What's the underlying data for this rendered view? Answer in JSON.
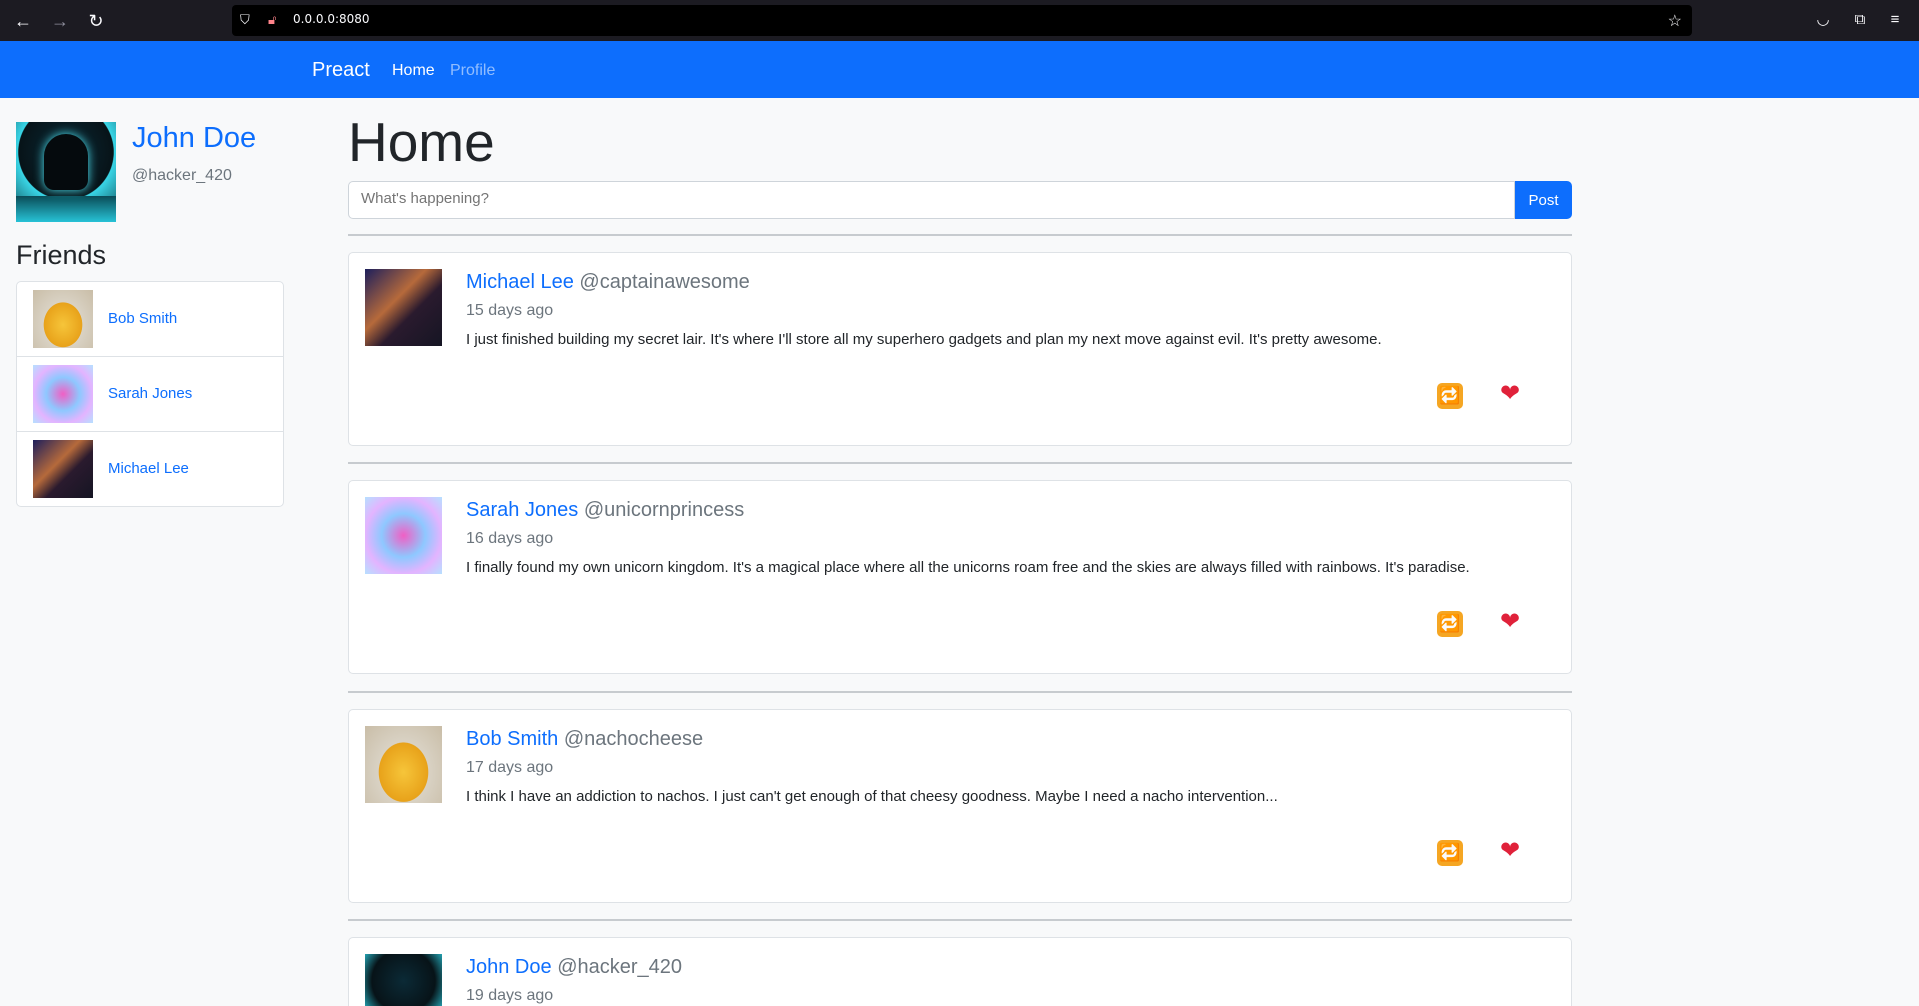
{
  "browser": {
    "url": "0.0.0.0:8080"
  },
  "navbar": {
    "brand": "Preact",
    "links": [
      "Home",
      "Profile"
    ]
  },
  "profile": {
    "name": "John Doe",
    "handle": "@hacker_420"
  },
  "friends": {
    "title": "Friends",
    "items": [
      {
        "name": "Bob Smith",
        "avatar": "nacho-cheese-photo"
      },
      {
        "name": "Sarah Jones",
        "avatar": "unicorn-photo"
      },
      {
        "name": "Michael Lee",
        "avatar": "superhero-photo"
      }
    ]
  },
  "main": {
    "title": "Home",
    "compose_placeholder": "What's happening?",
    "post_label": "Post"
  },
  "posts": [
    {
      "name": "Michael Lee",
      "handle": "@captainawesome",
      "time": "15 days ago",
      "body": "I just finished building my secret lair. It's where I'll store all my superhero gadgets and plan my next move against evil. It's pretty awesome.",
      "avatar": "superhero-photo"
    },
    {
      "name": "Sarah Jones",
      "handle": "@unicornprincess",
      "time": "16 days ago",
      "body": "I finally found my own unicorn kingdom. It's a magical place where all the unicorns roam free and the skies are always filled with rainbows. It's paradise.",
      "avatar": "unicorn-photo"
    },
    {
      "name": "Bob Smith",
      "handle": "@nachocheese",
      "time": "17 days ago",
      "body": "I think I have an addiction to nachos. I just can't get enough of that cheesy goodness. Maybe I need a nacho intervention...",
      "avatar": "nacho-cheese-photo"
    },
    {
      "name": "John Doe",
      "handle": "@hacker_420",
      "time": "19 days ago",
      "body": "",
      "avatar": "hacker-photo"
    }
  ],
  "icons": {
    "retweet": "🔁",
    "like": "❤"
  },
  "colors": {
    "primary": "#0d6efd",
    "retweet": "#f5a623",
    "like": "#e0213a"
  }
}
